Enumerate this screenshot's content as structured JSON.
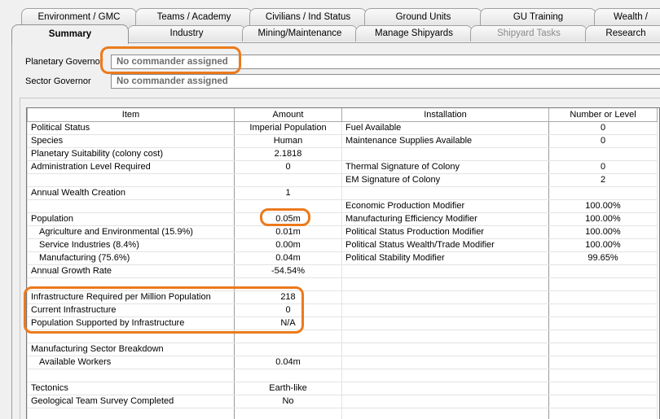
{
  "tabs_row1": [
    "Environment / GMC",
    "Teams / Academy",
    "Civilians / Ind Status",
    "Ground Units",
    "GU Training",
    "Wealth / "
  ],
  "tabs_row2": [
    "Summary",
    "Industry",
    "Mining/Maintenance",
    "Manage Shipyards",
    "Shipyard Tasks",
    "Research"
  ],
  "active_tab": "Summary",
  "governors": {
    "planetary_label": "Planetary Governor",
    "planetary_value": "No commander assigned",
    "sector_label": "Sector Governor",
    "sector_value": "No commander assigned"
  },
  "table": {
    "headers": [
      "Item",
      "Amount",
      "Installation",
      "Number or Level"
    ],
    "rows": [
      [
        "Political Status",
        "Imperial Population",
        "Fuel Available",
        "0"
      ],
      [
        "Species",
        "Human",
        "Maintenance Supplies Available",
        "0"
      ],
      [
        "Planetary Suitability (colony cost)",
        "2.1818",
        "",
        ""
      ],
      [
        "Administration Level Required",
        "0",
        "Thermal Signature of Colony",
        "0"
      ],
      [
        "",
        "",
        "EM Signature of Colony",
        "2"
      ],
      [
        "Annual Wealth Creation",
        "1",
        "",
        ""
      ],
      [
        "",
        "",
        "Economic Production Modifier",
        "100.00%"
      ],
      [
        "Population",
        "0.05m",
        "Manufacturing Efficiency Modifier",
        "100.00%"
      ],
      [
        "   Agriculture and Environmental  (15.9%)",
        "0.01m",
        "Political Status Production Modifier",
        "100.00%"
      ],
      [
        "   Service Industries  (8.4%)",
        "0.00m",
        "Political Status Wealth/Trade Modifier",
        "100.00%"
      ],
      [
        "   Manufacturing  (75.6%)",
        "0.04m",
        "Political Stability Modifier",
        "99.65%"
      ],
      [
        "Annual Growth Rate",
        "-54.54%",
        "",
        ""
      ],
      [
        "",
        "",
        "",
        ""
      ],
      [
        "Infrastructure Required per Million Population",
        "218",
        "",
        ""
      ],
      [
        "Current Infrastructure",
        "0",
        "",
        ""
      ],
      [
        "Population Supported by Infrastructure",
        "N/A",
        "",
        ""
      ],
      [
        "",
        "",
        "",
        ""
      ],
      [
        "Manufacturing Sector Breakdown",
        "",
        "",
        ""
      ],
      [
        "   Available Workers",
        "0.04m",
        "",
        ""
      ],
      [
        "",
        "",
        "",
        ""
      ],
      [
        "Tectonics",
        "Earth-like",
        "",
        ""
      ],
      [
        "Geological Team Survey Completed",
        "No",
        "",
        ""
      ],
      [
        "",
        "",
        "",
        ""
      ]
    ]
  }
}
